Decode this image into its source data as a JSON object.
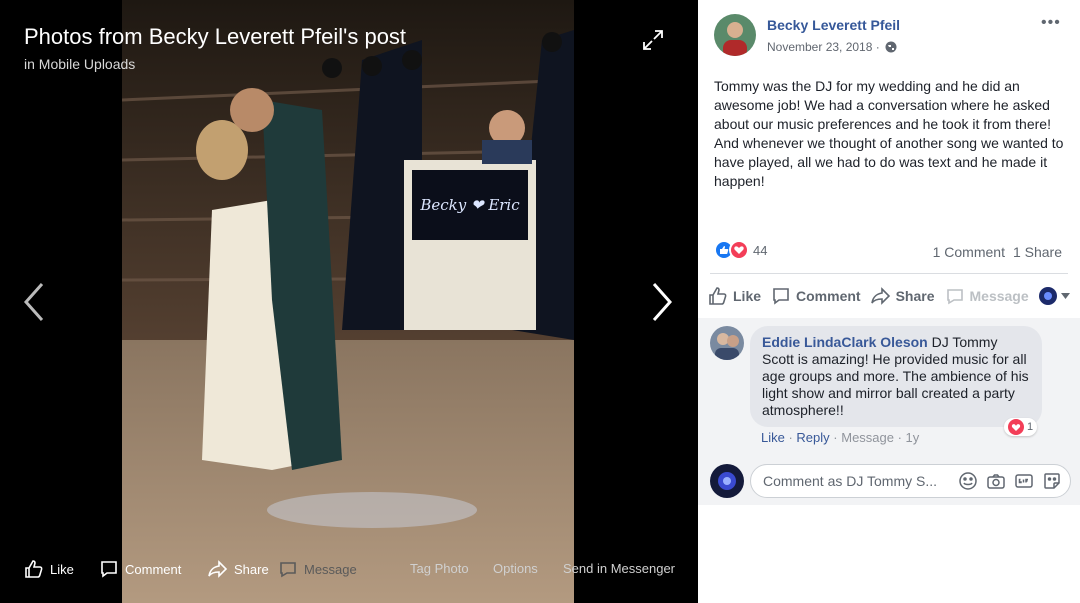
{
  "viewer": {
    "title": "Photos from Becky Leverett Pfeil's post",
    "subtitle": "in Mobile Uploads",
    "photo_text_sign": "Becky ❤ Eric",
    "toolbar": {
      "like": "Like",
      "comment": "Comment",
      "share": "Share",
      "message": "Message",
      "tag_photo": "Tag Photo",
      "options": "Options",
      "send_in_messenger": "Send in Messenger"
    }
  },
  "post": {
    "author": "Becky Leverett Pfeil",
    "date": "November 23, 2018 ·",
    "more": "•••",
    "text": "Tommy was the DJ for my wedding and he did an awesome job! We had a conversation where he asked about our music preferences and he took it from there! And whenever we thought of another song we wanted to have played, all we had to do was text and he made it happen!",
    "reactions_count": "44",
    "comments_count": "1 Comment",
    "shares_count": "1 Share",
    "actions": {
      "like": "Like",
      "comment": "Comment",
      "share": "Share",
      "message": "Message"
    }
  },
  "comment": {
    "name": "Eddie LindaClark Oleson",
    "text": " DJ Tommy Scott is amazing! He provided music for all age groups and more. The ambience of his light show and mirror ball created a party atmosphere!!",
    "love_count": "1",
    "like": "Like",
    "reply": "Reply",
    "message": "Message",
    "age": "1y",
    "sep": " · "
  },
  "composer": {
    "placeholder": "Comment as DJ Tommy S..."
  },
  "colors": {
    "link_blue": "#365899",
    "like_blue": "#1877f2",
    "love_red": "#f33e58"
  }
}
